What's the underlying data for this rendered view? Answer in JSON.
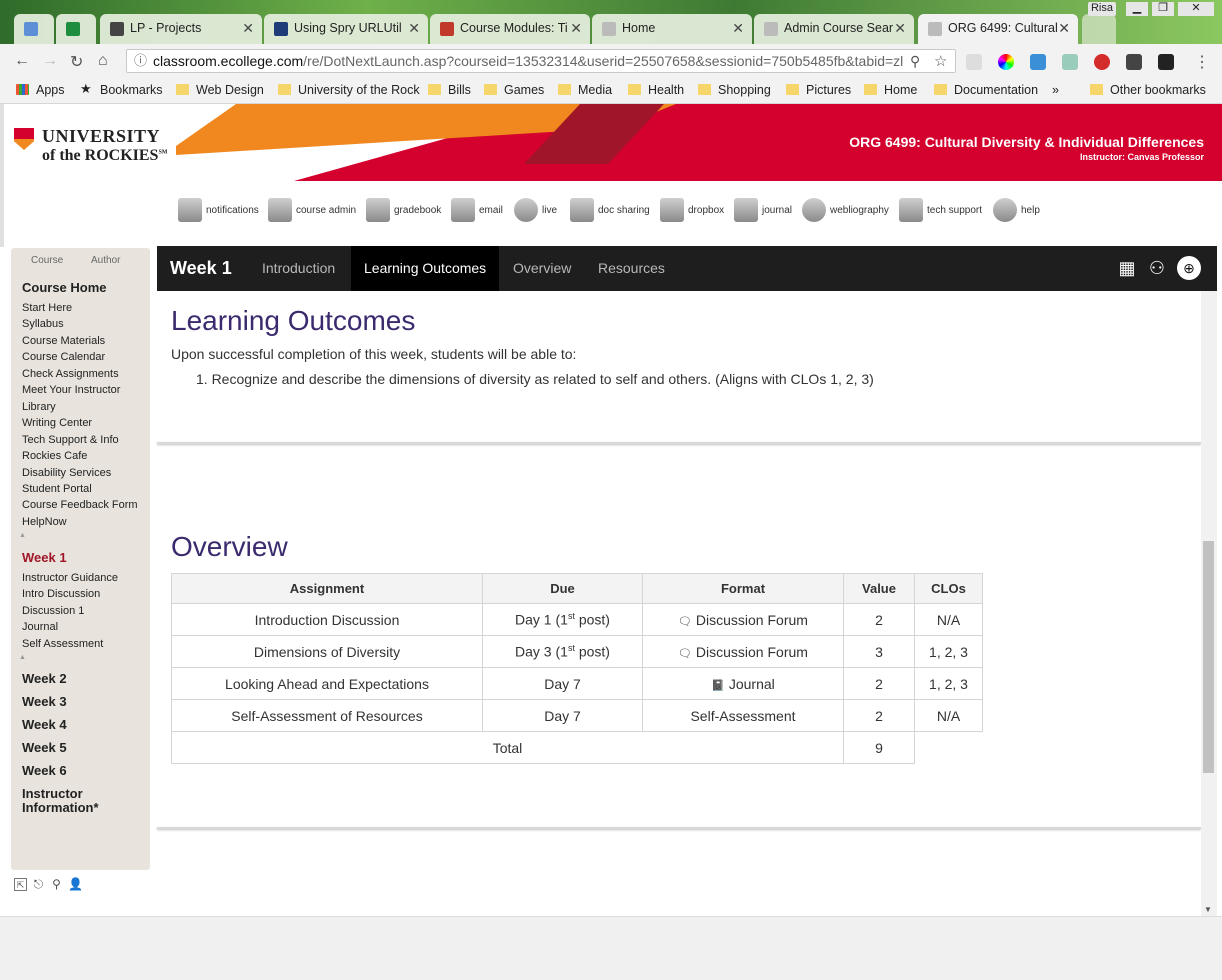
{
  "browser": {
    "tabs": [
      {
        "label": ""
      },
      {
        "label": ""
      },
      {
        "label": "LP - Projects"
      },
      {
        "label": "Using Spry URLUtil"
      },
      {
        "label": "Course Modules: Ti"
      },
      {
        "label": "Home"
      },
      {
        "label": "Admin Course Sear"
      },
      {
        "label": "ORG 6499: Cultural"
      }
    ],
    "profile": "Risa",
    "url_host": "classroom.ecollege.com",
    "url_path": "/re/DotNextLaunch.asp?courseid=13532314&userid=25507658&sessionid=750b5485fb&tabid=zl",
    "bookmarks": [
      "Apps",
      "Bookmarks",
      "Web Design",
      "University of the Rock",
      "Bills",
      "Games",
      "Media",
      "Health",
      "Shopping",
      "Pictures",
      "Home",
      "Documentation",
      "»",
      "Other bookmarks"
    ]
  },
  "banner": {
    "logo_line1": "UNIVERSITY",
    "logo_line2": "of the ROCKIES",
    "logo_sm": "SM",
    "course_title": "ORG 6499: Cultural Diversity & Individual Differences",
    "instructor": "Instructor:  Canvas Professor"
  },
  "tools": [
    "notifications",
    "course admin",
    "gradebook",
    "email",
    "live",
    "doc sharing",
    "dropbox",
    "journal",
    "webliography",
    "tech support",
    "help"
  ],
  "leftnav": {
    "tab_course": "Course",
    "tab_author": "Author",
    "course_home": "Course Home",
    "home_items": [
      "Start Here",
      "Syllabus",
      "Course Materials",
      "Course Calendar",
      "Check Assignments",
      "Meet Your Instructor",
      "Library",
      "Writing Center",
      "Tech Support & Info",
      "Rockies Cafe",
      "Disability Services",
      "Student Portal",
      "Course Feedback Form",
      "HelpNow"
    ],
    "week1": "Week 1",
    "week1_items": [
      "Instructor Guidance",
      "Intro Discussion",
      "Discussion 1",
      "Journal",
      "Self Assessment"
    ],
    "weeks": [
      "Week 2",
      "Week 3",
      "Week 4",
      "Week 5",
      "Week 6"
    ],
    "instructor_info_1": "Instructor",
    "instructor_info_2": "Information*"
  },
  "weekbar": {
    "title": "Week 1",
    "tabs": [
      "Introduction",
      "Learning Outcomes",
      "Overview",
      "Resources"
    ],
    "active_tab": "Learning Outcomes"
  },
  "outcomes": {
    "heading": "Learning Outcomes",
    "intro": "Upon successful completion of this week, students will be able to:",
    "items": [
      "1. Recognize and describe the dimensions of diversity as related to self and others. (Aligns with CLOs 1, 2, 3)"
    ]
  },
  "overview": {
    "heading": "Overview",
    "columns": [
      "Assignment",
      "Due",
      "Format",
      "Value",
      "CLOs"
    ],
    "rows": [
      {
        "assignment": "Introduction Discussion",
        "due": "Day 1 (1",
        "due_sup": "st",
        "due_end": " post)",
        "format_icon": "discussion-icon",
        "format": "Discussion Forum",
        "value": "2",
        "clos": "N/A"
      },
      {
        "assignment": "Dimensions of Diversity",
        "due": "Day 3 (1",
        "due_sup": "st",
        "due_end": " post)",
        "format_icon": "discussion-icon",
        "format": "Discussion Forum",
        "value": "3",
        "clos": "1, 2, 3"
      },
      {
        "assignment": "Looking Ahead and Expectations",
        "due": "Day 7",
        "due_sup": "",
        "due_end": "",
        "format_icon": "journal-icon",
        "format": "Journal",
        "value": "2",
        "clos": "1, 2, 3"
      },
      {
        "assignment": "Self-Assessment of Resources",
        "due": "Day 7",
        "due_sup": "",
        "due_end": "",
        "format_icon": "",
        "format": "Self-Assessment",
        "value": "2",
        "clos": "N/A"
      }
    ],
    "total_label": "Total",
    "total_value": "9"
  },
  "colors": {
    "accent_red": "#d4002d",
    "accent_orange": "#f0881f",
    "heading_purple": "#3b2a6e",
    "week_red": "#a01628"
  }
}
